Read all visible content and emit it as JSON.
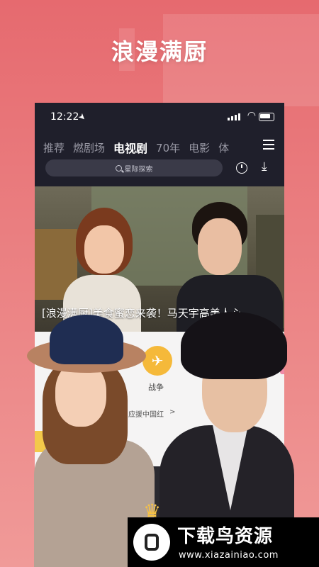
{
  "headline": "浪漫满厨",
  "status_bar": {
    "time": "12:22"
  },
  "tabs": [
    {
      "label": "推荐"
    },
    {
      "label": "燃剧场"
    },
    {
      "label": "电视剧",
      "active": true
    },
    {
      "label": "70年"
    },
    {
      "label": "电影"
    },
    {
      "label": "体"
    }
  ],
  "search": {
    "placeholder": "星际探索"
  },
  "banner": {
    "caption": "[浪漫满厨]美食蜜恋来袭！马天宇高美人心"
  },
  "category": {
    "label": "战争"
  },
  "sub_entry": {
    "label": "应援中国红",
    "arrow": ">"
  },
  "watermark": {
    "title": "下载鸟资源",
    "url": "www.xiazainiao.com"
  },
  "colors": {
    "accent": "#e66a6f",
    "phone_bg": "#1f1f2b",
    "category": "#f5b93a"
  }
}
